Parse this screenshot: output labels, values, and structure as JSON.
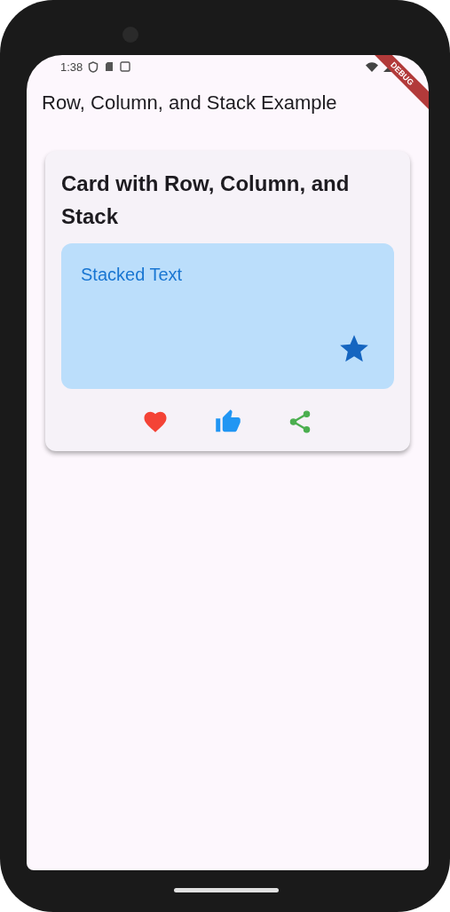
{
  "status_bar": {
    "time": "1:38"
  },
  "debug_banner": "DEBUG",
  "app_bar": {
    "title": "Row, Column, and Stack Example"
  },
  "card": {
    "title": "Card with Row, Column, and Stack",
    "stacked_text": "Stacked Text",
    "actions": [
      {
        "kind": "heart",
        "color": "#f44336"
      },
      {
        "kind": "thumb",
        "color": "#2196f3"
      },
      {
        "kind": "share",
        "color": "#4caf50"
      }
    ]
  }
}
